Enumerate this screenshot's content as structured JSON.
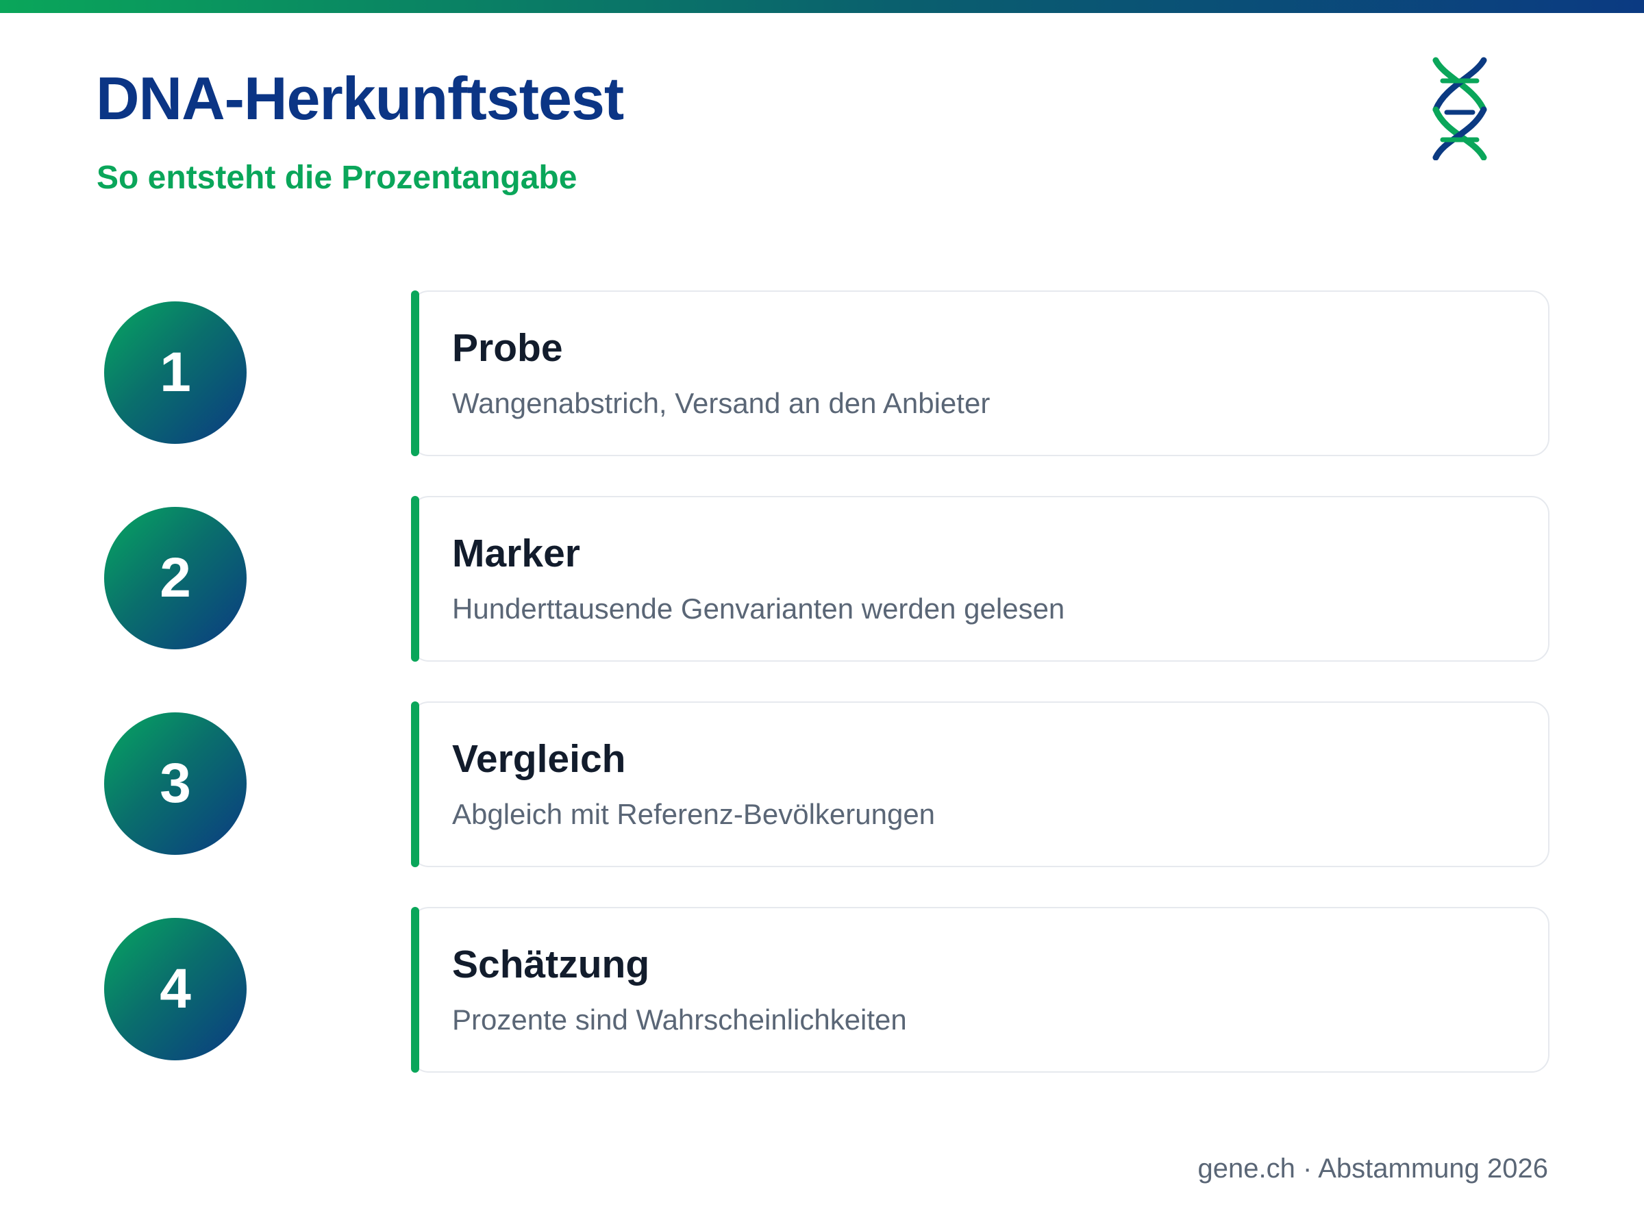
{
  "header": {
    "title": "DNA-Herkunftstest",
    "subtitle": "So entsteht die Prozentangabe",
    "logo_icon": "dna-helix-icon"
  },
  "steps": [
    {
      "number": "1",
      "title": "Probe",
      "description": "Wangenabstrich, Versand an den Anbieter"
    },
    {
      "number": "2",
      "title": "Marker",
      "description": "Hunderttausende Genvarianten werden gelesen"
    },
    {
      "number": "3",
      "title": "Vergleich",
      "description": "Abgleich mit Referenz-Bevölkerungen"
    },
    {
      "number": "4",
      "title": "Schätzung",
      "description": "Prozente sind Wahrscheinlichkeiten"
    }
  ],
  "footer": {
    "text": "gene.ch · Abstammung 2026"
  },
  "colors": {
    "title": "#0b3585",
    "accent_green": "#0aa65a",
    "navy": "#0b3a82",
    "step_title": "#121c2c",
    "muted_text": "#5a6676",
    "card_border": "#e6e9ee"
  }
}
